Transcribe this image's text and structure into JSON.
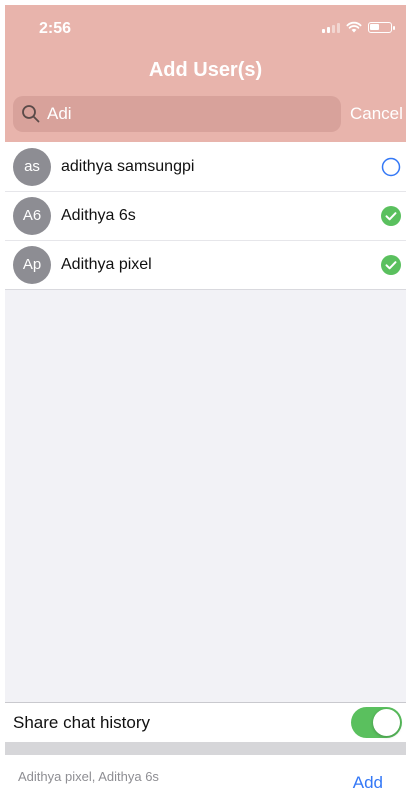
{
  "status_bar": {
    "time": "2:56"
  },
  "header": {
    "title": "Add User(s)"
  },
  "search": {
    "value": "Adi",
    "cancel_label": "Cancel"
  },
  "users": [
    {
      "initials": "as",
      "name": "adithya samsungpi",
      "selected": false
    },
    {
      "initials": "A6",
      "name": "Adithya 6s",
      "selected": true
    },
    {
      "initials": "Ap",
      "name": "Adithya pixel",
      "selected": true
    }
  ],
  "share_history": {
    "label": "Share chat history",
    "enabled": true
  },
  "footer": {
    "selected_summary": "Adithya pixel, Adithya 6s",
    "add_label": "Add"
  },
  "colors": {
    "header_bg": "#e8b4ac",
    "accent_blue": "#3478f6",
    "check_green": "#5ac05e",
    "avatar_gray": "#8d8d93"
  }
}
